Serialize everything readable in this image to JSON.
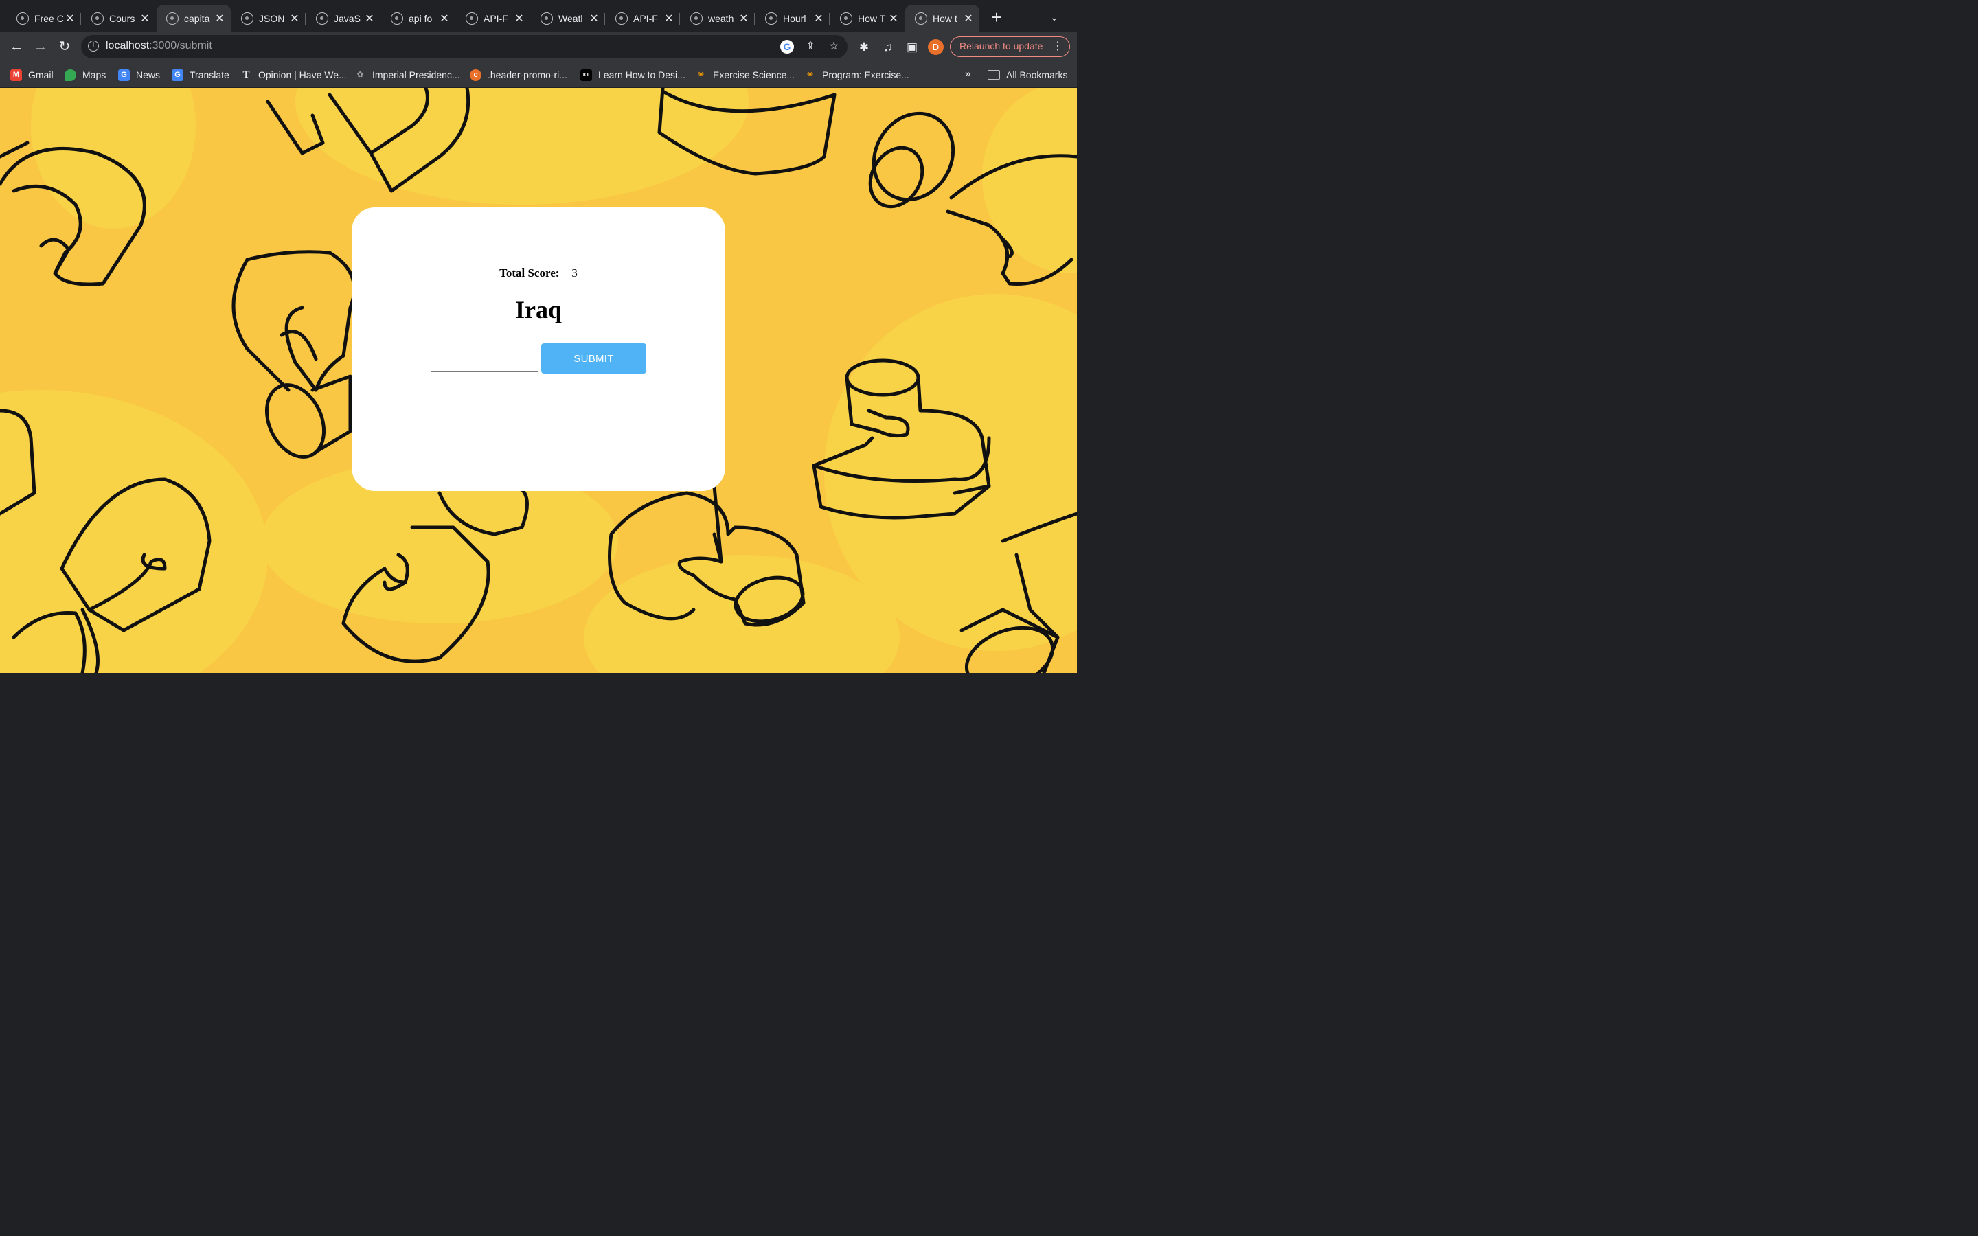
{
  "browser": {
    "tabs": [
      {
        "title": "Free C"
      },
      {
        "title": "Cours"
      },
      {
        "title": "capita"
      },
      {
        "title": "JSON"
      },
      {
        "title": "JavaS"
      },
      {
        "title": "api fo"
      },
      {
        "title": "API-F"
      },
      {
        "title": "Weatl"
      },
      {
        "title": "API-F"
      },
      {
        "title": "weath"
      },
      {
        "title": "Hourl"
      },
      {
        "title": "How T"
      },
      {
        "title": "How t"
      }
    ],
    "address": {
      "host": "localhost",
      "path": ":3000/submit"
    },
    "avatar_letter": "D",
    "relaunch_label": "Relaunch to update",
    "bookmarks": [
      {
        "label": "Gmail"
      },
      {
        "label": "Maps"
      },
      {
        "label": "News"
      },
      {
        "label": "Translate"
      },
      {
        "label": "Opinion | Have We..."
      },
      {
        "label": "Imperial Presidenc..."
      },
      {
        "label": ".header-promo-ri..."
      },
      {
        "label": "Learn How to Desi..."
      },
      {
        "label": "Exercise Science..."
      },
      {
        "label": "Program: Exercise..."
      }
    ],
    "bookmarks_more": "»",
    "all_bookmarks_label": "All Bookmarks"
  },
  "page": {
    "score_label": "Total Score:",
    "score_value": "3",
    "country": "Iraq",
    "answer_value": "",
    "submit_label": "SUBMIT"
  },
  "colors": {
    "background": "#f9c744",
    "card": "#ffffff",
    "button": "#4fb3f6",
    "relaunch": "#f28b82"
  }
}
